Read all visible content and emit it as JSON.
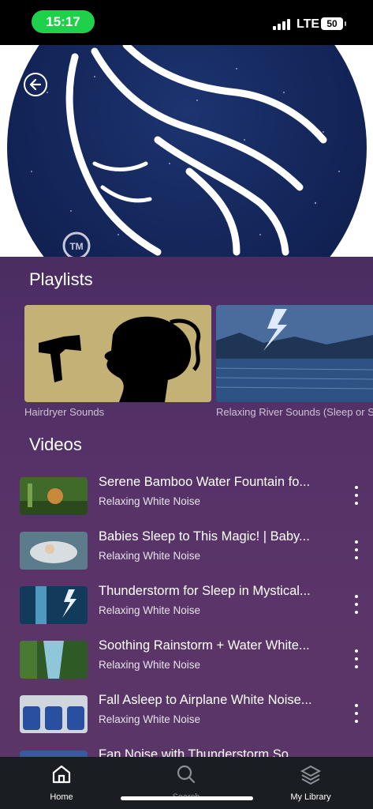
{
  "status_bar": {
    "time": "15:17",
    "network": "LTE",
    "battery": "50"
  },
  "hero": {
    "tm_mark": "TM"
  },
  "playlists": {
    "title": "Playlists",
    "items": [
      {
        "label": "Hairdryer Sounds"
      },
      {
        "label": "Relaxing River Sounds (Sleep or Study)"
      }
    ]
  },
  "videos": {
    "title": "Videos",
    "items": [
      {
        "title": "Serene Bamboo Water Fountain fo...",
        "channel": "Relaxing White Noise"
      },
      {
        "title": "Babies Sleep to This Magic! | Baby...",
        "channel": "Relaxing White Noise"
      },
      {
        "title": "Thunderstorm for Sleep in Mystical...",
        "channel": "Relaxing White Noise"
      },
      {
        "title": "Soothing Rainstorm + Water White...",
        "channel": "Relaxing White Noise"
      },
      {
        "title": "Fall Asleep to Airplane White Noise...",
        "channel": "Relaxing White Noise"
      },
      {
        "title": "Fan Noise with Thunderstorm So...",
        "channel": ""
      }
    ]
  },
  "bottom_nav": {
    "home": "Home",
    "search": "Search",
    "library": "My Library"
  },
  "colors": {
    "accent_green": "#1fd14a",
    "background_top": "#3a2450",
    "background_bottom": "#5a3566",
    "nav_bg": "#1a1d22"
  }
}
